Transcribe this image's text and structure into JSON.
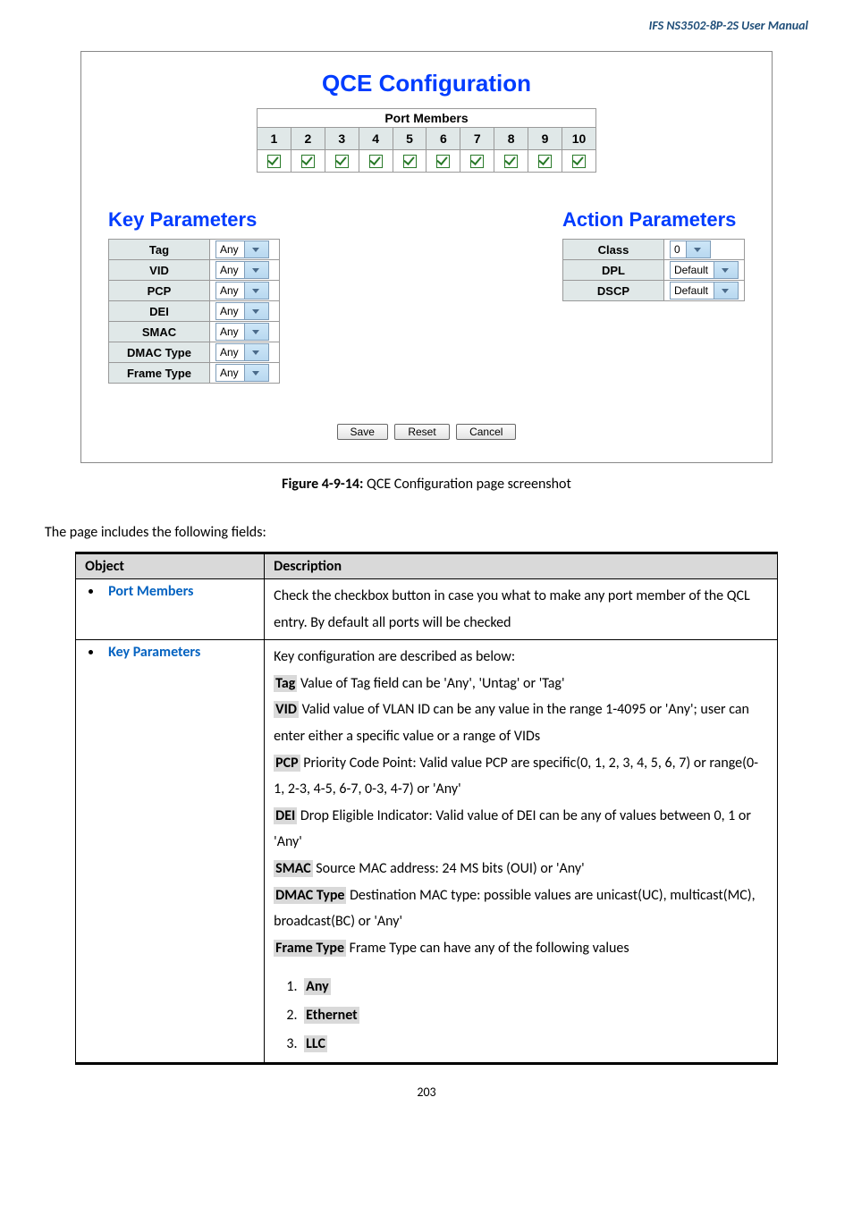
{
  "header": "IFS  NS3502-8P-2S  User  Manual",
  "figure": {
    "title": "QCE Configuration",
    "port_members_label": "Port Members",
    "ports": [
      "1",
      "2",
      "3",
      "4",
      "5",
      "6",
      "7",
      "8",
      "9",
      "10"
    ],
    "key_params_title": "Key Parameters",
    "action_params_title": "Action Parameters",
    "key_rows": [
      {
        "label": "Tag",
        "value": "Any"
      },
      {
        "label": "VID",
        "value": "Any"
      },
      {
        "label": "PCP",
        "value": "Any"
      },
      {
        "label": "DEI",
        "value": "Any"
      },
      {
        "label": "SMAC",
        "value": "Any"
      },
      {
        "label": "DMAC Type",
        "value": "Any"
      },
      {
        "label": "Frame Type",
        "value": "Any"
      }
    ],
    "action_rows": [
      {
        "label": "Class",
        "value": "0"
      },
      {
        "label": "DPL",
        "value": "Default"
      },
      {
        "label": "DSCP",
        "value": "Default"
      }
    ],
    "buttons": {
      "save": "Save",
      "reset": "Reset",
      "cancel": "Cancel"
    }
  },
  "caption_b": "Figure 4-9-14:",
  "caption_r": " QCE Configuration page screenshot",
  "intro": "The page includes the following fields:",
  "table": {
    "h1": "Object",
    "h2": "Description",
    "r1_obj": "Port Members",
    "r1_desc": "Check the checkbox button in case you what to make any port member of the QCL entry. By default all ports will be checked",
    "r2_obj": "Key Parameters",
    "r2": {
      "l0": "Key configuration are described as below:",
      "tag_b": "Tag",
      "tag_t": " Value of Tag field can be 'Any', 'Untag' or 'Tag'",
      "vid_b": "VID",
      "vid_t": " Valid value of VLAN ID can be any value in the range 1-4095 or 'Any'; user can enter either a specific value or a range of VIDs",
      "pcp_b": "PCP",
      "pcp_t": " Priority Code Point: Valid value PCP are specific(0, 1, 2, 3, 4, 5, 6, 7) or range(0-1, 2-3, 4-5, 6-7, 0-3, 4-7) or 'Any'",
      "dei_b": "DEI",
      "dei_t": " Drop Eligible Indicator: Valid value of DEI can be any of values between 0, 1 or 'Any'",
      "smac_b": "SMAC",
      "smac_t": " Source MAC address: 24 MS bits (OUI) or 'Any'",
      "dmac_b": "DMAC Type",
      "dmac_t": " Destination MAC type: possible values are unicast(UC), multicast(MC), broadcast(BC) or 'Any'",
      "ft_b": "Frame Type",
      "ft_t": " Frame Type can have any of the following values",
      "li1": "Any",
      "li2": "Ethernet",
      "li3": "LLC"
    }
  },
  "page_num": "203"
}
